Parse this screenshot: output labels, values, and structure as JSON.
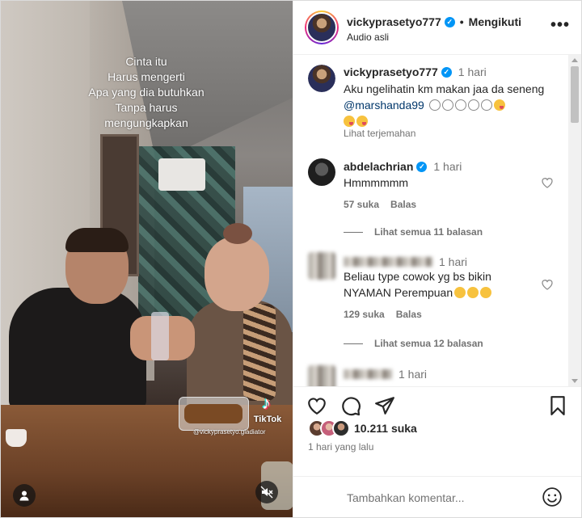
{
  "video": {
    "overlay_lines": [
      "Cinta itu",
      "Harus mengerti",
      "Apa yang dia butuhkan",
      "Tanpa harus",
      "mengungkapkan"
    ],
    "tiktok_label": "TikTok",
    "tiktok_handle": "@vickyprasetyo.gladiator"
  },
  "header": {
    "username": "vickyprasetyo777",
    "separator": "•",
    "follow_status": "Mengikuti",
    "audio": "Audio asli"
  },
  "caption": {
    "username": "vickyprasetyo777",
    "time": "1 hari",
    "text": "Aku ngelihatin km makan jaa da seneng",
    "mention": "@marshanda99",
    "translate": "Lihat terjemahan"
  },
  "comments": [
    {
      "username": "abdelachrian",
      "verified": true,
      "time": "1 hari",
      "text": "Hmmmmmm",
      "likes": "57 suka",
      "reply": "Balas",
      "view_replies": "Lihat semua 11 balasan"
    },
    {
      "username": "",
      "time": "1 hari",
      "text": "Beliau type cowok yg bs bikin NYAMAN Perempuan",
      "likes": "129 suka",
      "reply": "Balas",
      "view_replies": "Lihat semua 12 balasan"
    },
    {
      "username": "",
      "time": "1 hari"
    }
  ],
  "post": {
    "likes": "10.211 suka",
    "time_ago": "1 hari yang lalu"
  },
  "comment_box": {
    "placeholder": "Tambahkan komentar..."
  },
  "colors": {
    "verified": "#0095f6",
    "mention": "#00376b",
    "secondary_text": "#737373"
  }
}
